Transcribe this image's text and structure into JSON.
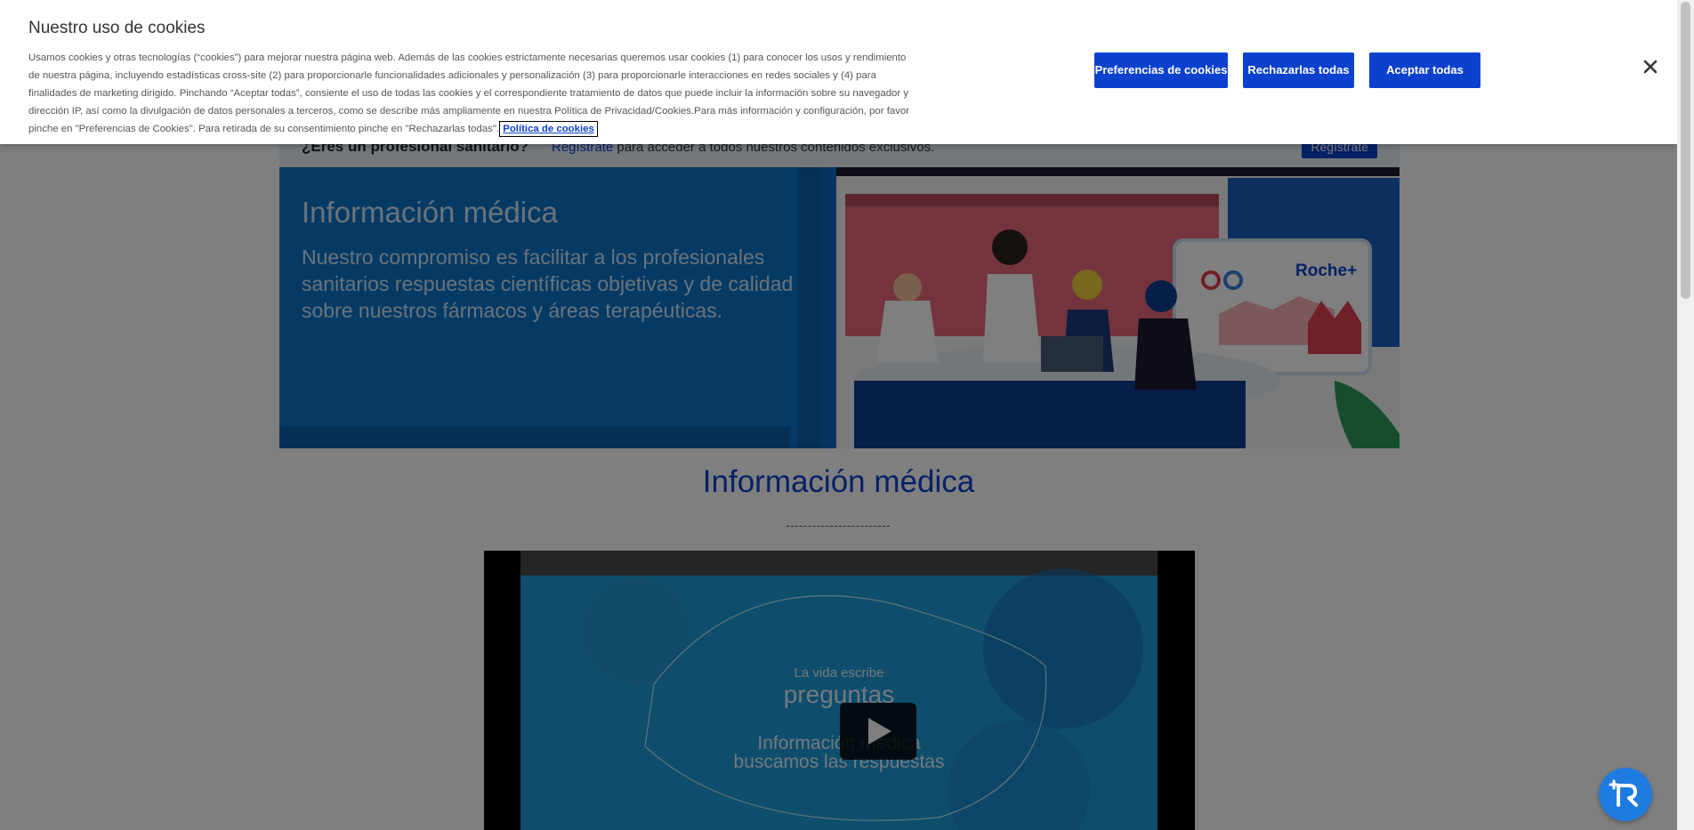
{
  "cookie_banner": {
    "title": "Nuestro uso de cookies",
    "body_text": "Usamos cookies y otras tecnologías (“cookies”) para mejorar nuestra página web. Además de las cookies estrictamente necesarias queremos usar cookies (1) para conocer los usos y rendimiento de nuestra página, incluyendo estadísticas cross-site (2) para proporcionarle funcionalidades adicionales y personalización (3) para proporcionarle interacciones en redes sociales y (4) para finalidades de marketing dirigido. Pinchando “Aceptar todas”, consiente el uso de todas las cookies y el correspondiente tratamiento de datos que puede incluir la información sobre su navegador y dirección IP, así como la divulgación de datos personales a terceros, como se describe más ampliamente en nuestra Política de Privacidad/Cookies.Para más información y configuración, por favor pinche en \"Preferencias de Cookies\". Para retirada de su consentimiento pinche en \"Rechazarlas todas\".",
    "policy_link": "Política de cookies",
    "preferences_button": "Preferencias de cookies",
    "reject_button": "Rechazarlas todas",
    "accept_button": "Aceptar todas",
    "close_icon": "close-icon"
  },
  "registration_bar": {
    "question": "¿Eres un profesional sanitario?",
    "link": "Regístrate",
    "text": " para acceder a todos nuestros contenidos exclusivos.",
    "button": "Regístrate"
  },
  "hero": {
    "title": "Información médica",
    "description": "Nuestro compromiso es facilitar a los profesionales sanitarios respuestas científicas objetivas y de calidad sobre nuestros fármacos y áreas terapéuticas.",
    "illustration_brand": "Roche+"
  },
  "section": {
    "title": "Información médica"
  },
  "video": {
    "line1": "La vida escribe",
    "line2": "preguntas",
    "line3a": "Información médica",
    "line3b": "buscamos las respuestas",
    "play_icon": "play-icon"
  },
  "colors": {
    "roche_blue": "#0b41cd",
    "hero_blue": "#0b74c9",
    "video_blue": "#1d9bd8",
    "chat_blue": "#1e7be0"
  }
}
